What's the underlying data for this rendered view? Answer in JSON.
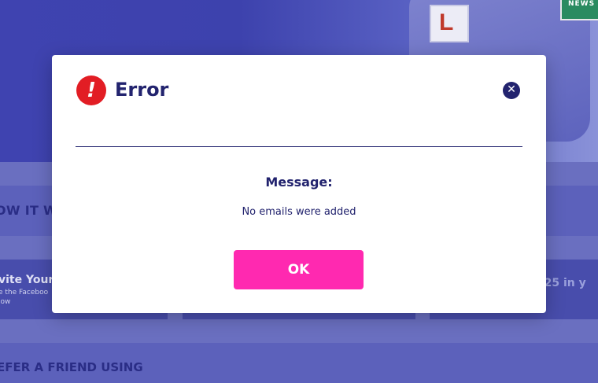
{
  "page": {
    "how_it_works": "OW IT W",
    "card1_title": "vite Your",
    "card1_sub_line1": "e the Faceboo",
    "card1_sub_line2": "low",
    "card3_title": "nd;25 in y",
    "refer_title": "EFER A FRIEND USING",
    "hero_plate": "L",
    "hero_sign": "NEWS"
  },
  "dialog": {
    "icon_glyph": "!",
    "title": "Error",
    "close_glyph": "✕",
    "message_label": "Message:",
    "message_text": "No emails were added",
    "ok_label": "OK"
  },
  "colors": {
    "accent": "#ff29b0",
    "error": "#e21d24",
    "navy": "#22236e"
  }
}
